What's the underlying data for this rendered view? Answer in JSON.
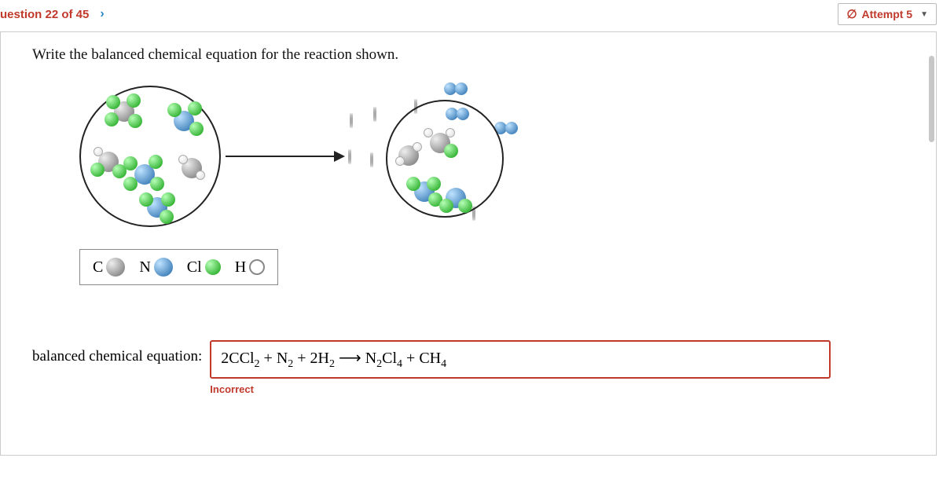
{
  "header": {
    "question_nav": "uestion 22 of 45",
    "attempt_label": "Attempt 5"
  },
  "prompt": "Write the balanced chemical equation for the reaction shown.",
  "legend": {
    "c": "C",
    "n": "N",
    "cl": "Cl",
    "h": "H"
  },
  "answer": {
    "label": "balanced chemical equation:",
    "value_html": "2CCl₂ + N₂ + 2H₂ ⟶ N₂Cl₄ + CH₄",
    "parts": {
      "a": "2CCl",
      "as": "2",
      "b": " + N",
      "bs": "2",
      "c": " + 2H",
      "cs": "2",
      "arrow": " ⟶ ",
      "d": "N",
      "ds1": "2",
      "d2": "Cl",
      "ds2": "4",
      "e": " + CH",
      "es": "4"
    },
    "feedback": "Incorrect"
  }
}
